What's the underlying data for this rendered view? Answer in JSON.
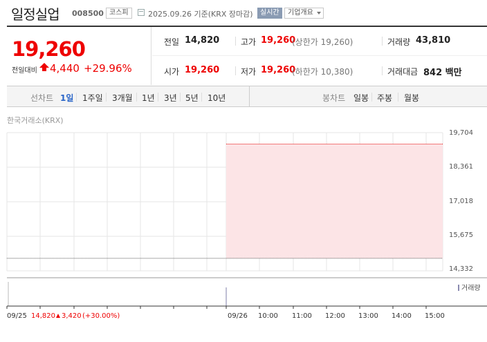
{
  "stock": {
    "name": "일정실업",
    "code": "008500",
    "market": "코스피",
    "date_text": "2025.09.26  기준(KRX 장마감)",
    "realtime_label": "실시간",
    "company_info_label": "기업개요",
    "price": "19,260",
    "change_label": "전일대비",
    "change_value": "4,440",
    "change_pct": "+29.96%"
  },
  "summary": {
    "prev_label": "전일",
    "prev_value": "14,820",
    "high_label": "고가",
    "high_value": "19,260",
    "upper_limit_text": "(상한가 19,260)",
    "volume_label": "거래량",
    "volume_value": "43,810",
    "open_label": "시가",
    "open_value": "19,260",
    "low_label": "저가",
    "low_value": "19,260",
    "lower_limit_text": "(하한가 10,380)",
    "amount_label": "거래대금",
    "amount_value": "842 백만"
  },
  "tabs": {
    "line_label": "선차트",
    "line_tabs": [
      "1일",
      "1주일",
      "3개월",
      "1년",
      "3년",
      "5년",
      "10년"
    ],
    "selected": "1일",
    "candle_label": "봉차트",
    "candle_tabs": [
      "일봉",
      "주봉",
      "월봉"
    ]
  },
  "chart": {
    "source_label": "한국거래소(KRX)",
    "volume_legend": "거래량",
    "colors": {
      "up": "#e60000",
      "fill": "#fce4e6",
      "grid": "#e6e6e6"
    }
  },
  "chart_data": {
    "type": "area",
    "y_ticks": [
      "19,704",
      "18,361",
      "17,018",
      "15,675",
      "14,332"
    ],
    "ylim": [
      14332,
      19704
    ],
    "x_ticks": [
      "09/25",
      "09/26",
      "10:00",
      "11:00",
      "12:00",
      "13:00",
      "14:00",
      "15:00"
    ],
    "prev_close": 14820,
    "series": [
      {
        "values": [
          19260,
          19260,
          19260,
          19260,
          19260,
          19260,
          19260
        ]
      }
    ],
    "grid": true
  },
  "footer": {
    "date": "09/25",
    "price": "14,820",
    "change": "3,420",
    "pct": "(+30.00%)"
  }
}
